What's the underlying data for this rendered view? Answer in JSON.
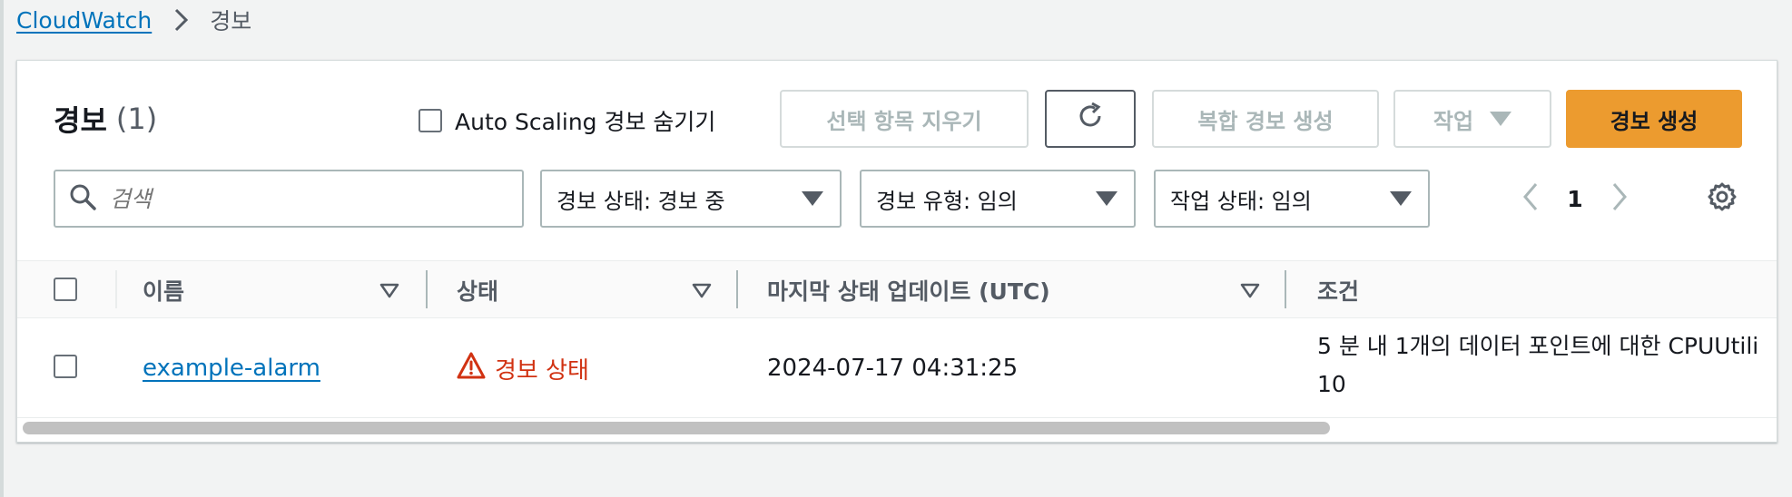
{
  "breadcrumb": {
    "root": "CloudWatch",
    "current": "경보"
  },
  "header": {
    "title": "경보",
    "count": "(1)"
  },
  "hide_autoscaling_label": "Auto Scaling 경보 숨기기",
  "toolbar": {
    "clear_label": "선택 항목 지우기",
    "composite_label": "복합 경보 생성",
    "actions_label": "작업",
    "create_label": "경보 생성"
  },
  "search": {
    "placeholder": "검색"
  },
  "filters": {
    "state": "경보 상태: 경보 중",
    "type": "경보 유형: 임의",
    "action_state": "작업 상태: 임의"
  },
  "pagination": {
    "page": "1"
  },
  "table": {
    "columns": [
      "이름",
      "상태",
      "마지막 상태 업데이트 (UTC)",
      "조건"
    ],
    "rows": [
      {
        "name": "example-alarm",
        "status": "경보 상태",
        "updated": "2024-07-17 04:31:25",
        "condition_line1": "5 분 내 1개의 데이터 포인트에 대한 CPUUtili",
        "condition_line2": "10"
      }
    ]
  },
  "colors": {
    "link": "#0073bb",
    "primary": "#ec9b2f",
    "alarm": "#d13212"
  }
}
